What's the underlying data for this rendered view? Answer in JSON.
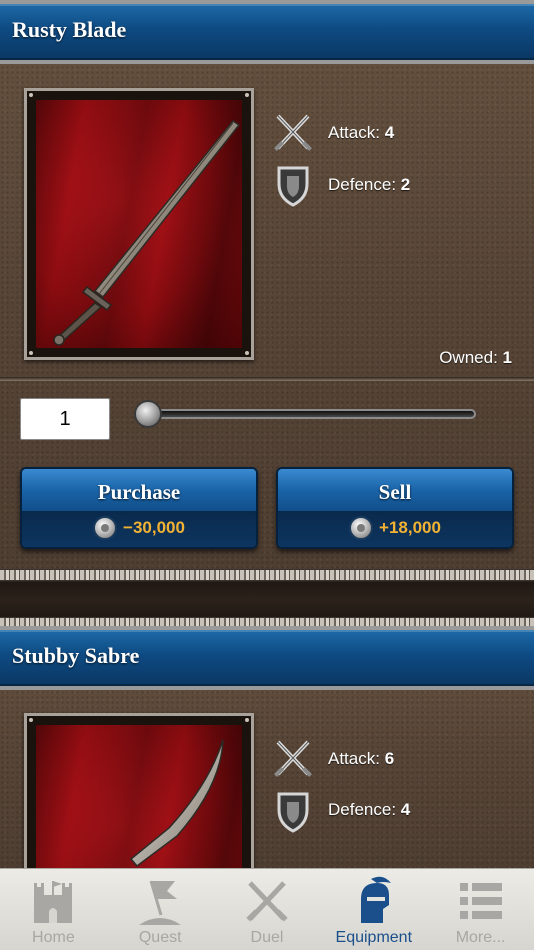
{
  "items": [
    {
      "title": "Rusty Blade",
      "attack_label": "Attack:",
      "attack_value": "4",
      "defence_label": "Defence:",
      "defence_value": "2",
      "owned_label": "Owned:",
      "owned_value": "1",
      "quantity": "1",
      "purchase": {
        "label": "Purchase",
        "price": "−30,000"
      },
      "sell": {
        "label": "Sell",
        "price": "+18,000"
      }
    },
    {
      "title": "Stubby Sabre",
      "attack_label": "Attack:",
      "attack_value": "6",
      "defence_label": "Defence:",
      "defence_value": "4"
    }
  ],
  "tabbar": {
    "tabs": [
      {
        "label": "Home",
        "icon": "castle-icon",
        "active": false
      },
      {
        "label": "Quest",
        "icon": "flag-icon",
        "active": false
      },
      {
        "label": "Duel",
        "icon": "crossed-swords-icon",
        "active": false
      },
      {
        "label": "Equipment",
        "icon": "knight-helmet-icon",
        "active": true
      },
      {
        "label": "More...",
        "icon": "list-icon",
        "active": false
      }
    ]
  },
  "colors": {
    "header_blue": "#0e4a82",
    "price_gold": "#f2b233",
    "active_tab": "#1b4f8c",
    "inactive_tab": "#a8a7a3"
  }
}
